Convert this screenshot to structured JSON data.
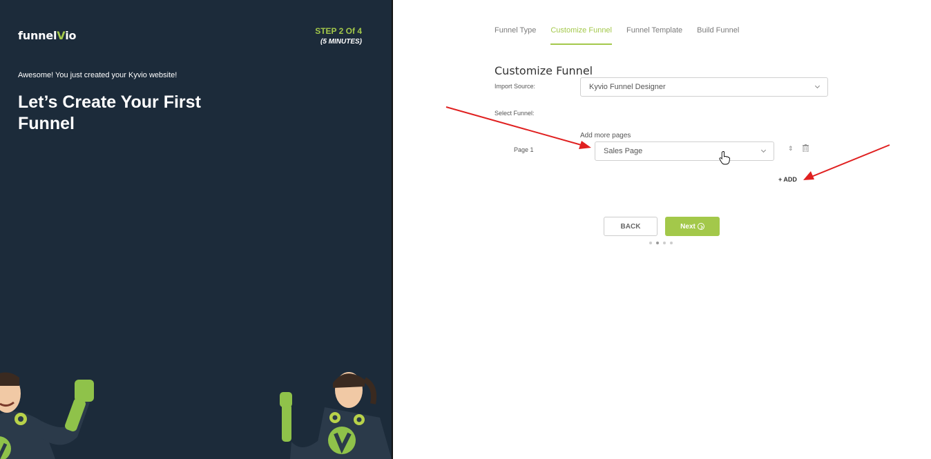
{
  "brand": {
    "logo_main": "funnel",
    "logo_v": "V",
    "logo_end": "io"
  },
  "step": {
    "title": "STEP 2 Of 4",
    "subtitle": "(5 MINUTES)"
  },
  "intro": {
    "message": "Awesome! You just created your Kyvio website!",
    "headline": "Let’s Create Your First Funnel"
  },
  "tabs": [
    {
      "label": "Funnel Type",
      "active": false
    },
    {
      "label": "Customize Funnel",
      "active": true
    },
    {
      "label": "Funnel Template",
      "active": false
    },
    {
      "label": "Build Funnel",
      "active": false
    }
  ],
  "form": {
    "title": "Customize Funnel",
    "import_label": "Import Source:",
    "import_value": "Kyvio Funnel Designer",
    "select_funnel_label": "Select Funnel:",
    "add_more_label": "Add more pages",
    "page_label": "Page 1",
    "page_value": "Sales Page",
    "sort_glyph": "⇕",
    "add_label": "+ ADD"
  },
  "buttons": {
    "back": "BACK",
    "next": "Next"
  },
  "progress": {
    "total_dots": 4,
    "current": 2
  },
  "colors": {
    "accent": "#a3c84a",
    "panel": "#1c2b3a",
    "annotation": "#e02020"
  },
  "icons": [
    "chevron-down-icon",
    "sort-icon",
    "trash-icon",
    "hand-cursor-icon",
    "next-arrow-icon"
  ]
}
